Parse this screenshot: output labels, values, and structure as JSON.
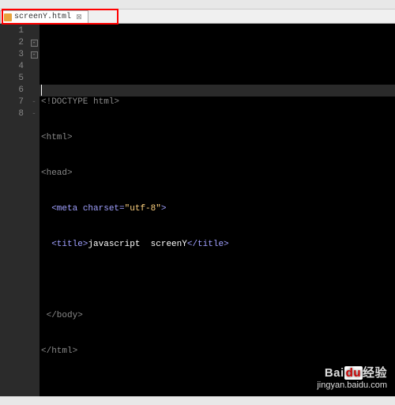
{
  "tab": {
    "filename": "screenY.html",
    "close_glyph": "⊠"
  },
  "gutter": {
    "lines": [
      "1",
      "2",
      "3",
      "4",
      "5",
      "6",
      "7",
      "8"
    ]
  },
  "code": {
    "l1_doctype": "<!DOCTYPE html>",
    "l2_open_html": "<html>",
    "l3_open_head": "<head>",
    "l4_meta_tag_open": "<meta",
    "l4_meta_attr": " charset=",
    "l4_meta_value": "\"utf-8\"",
    "l4_meta_close": ">",
    "l5_title_open": "<title>",
    "l5_title_text": "javascript  screenY",
    "l5_title_close": "</title>",
    "l6_empty": "",
    "l7_close_body": "</body>",
    "l8_close_html": "</html>"
  },
  "watermark": {
    "brand_pre": "Bai",
    "brand_du": "du",
    "brand_post": "经验",
    "url": "jingyan.baidu.com"
  }
}
